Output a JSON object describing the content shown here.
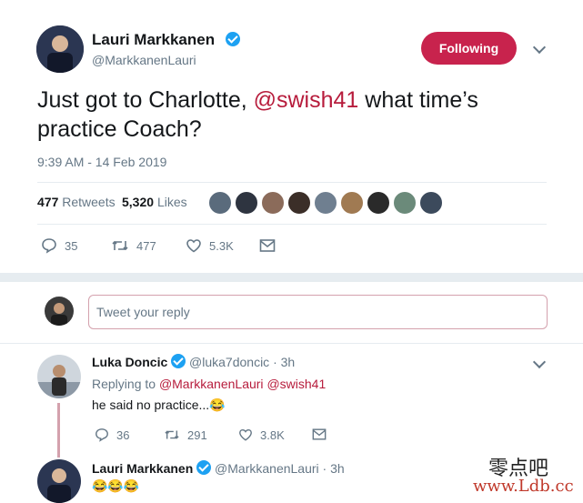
{
  "main_tweet": {
    "author_name": "Lauri Markkanen",
    "author_handle": "@MarkkanenLauri",
    "follow_label": "Following",
    "text_before": "Just got to Charlotte, ",
    "mention": "@swish41",
    "text_after": " what time’s practice Coach?",
    "timestamp": "9:39 AM - 14 Feb 2019",
    "retweets_count": "477",
    "retweets_label": "Retweets",
    "likes_count": "5,320",
    "likes_label": "Likes",
    "actions": {
      "replies": "35",
      "retweets": "477",
      "likes": "5.3K"
    }
  },
  "reply_box": {
    "placeholder": "Tweet your reply"
  },
  "reply_1": {
    "author_name": "Luka Doncic",
    "author_handle": "@luka7doncic",
    "time": "· 3h",
    "replying_to_label": "Replying to",
    "replying_to_1": "@MarkkanenLauri",
    "replying_to_2": "@swish41",
    "text": "he said no practice...😂",
    "actions": {
      "replies": "36",
      "retweets": "291",
      "likes": "3.8K"
    }
  },
  "reply_2": {
    "author_name": "Lauri Markkanen",
    "author_handle": "@MarkkanenLauri",
    "time": "· 3h",
    "text": "😂😂😂"
  },
  "watermark": {
    "line1": "零点吧",
    "line2": "www.Ldb.cc"
  },
  "colors": {
    "accent": "#c8234d",
    "mention": "#b71c3c",
    "verified": "#1da1f2",
    "muted": "#657786"
  }
}
